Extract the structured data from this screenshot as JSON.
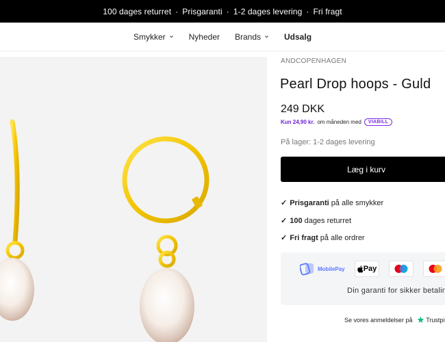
{
  "announcement": {
    "items": [
      "100 dages returret",
      "Prisgaranti",
      "1-2 dages levering",
      "Fri fragt"
    ],
    "separator": "·"
  },
  "nav": {
    "items": [
      {
        "label": "Smykker",
        "dropdown": true
      },
      {
        "label": "Nyheder",
        "dropdown": false
      },
      {
        "label": "Brands",
        "dropdown": true
      },
      {
        "label": "Udsalg",
        "dropdown": false
      }
    ]
  },
  "product": {
    "brand": "ANDCOPENHAGEN",
    "title": "Pearl Drop hoops - Guld",
    "price": "249 DKK",
    "installment_amount": "Kun 24,90 kr.",
    "installment_text": "om måneden med",
    "installment_provider": "VIABILL",
    "stock": "På lager: 1-2 dages levering",
    "add_to_cart": "Læg i kurv"
  },
  "usps": [
    {
      "bold": "Prisgaranti",
      "text": "på alle smykker"
    },
    {
      "bold": "100",
      "text": "dages returret"
    },
    {
      "bold": "Fri fragt",
      "text": "på alle ordrer"
    }
  ],
  "usp_check": "✓",
  "payment": {
    "mobilepay": "MobilePay",
    "applepay": "Pay",
    "guarantee": "Din garanti for sikker betaling"
  },
  "reviews": {
    "text": "Se vores anmeldelser på",
    "provider": "Trustpilot"
  },
  "colors": {
    "gold": "#f2c300",
    "accent_purple": "#7a2be0",
    "trustpilot_green": "#00b67a"
  }
}
